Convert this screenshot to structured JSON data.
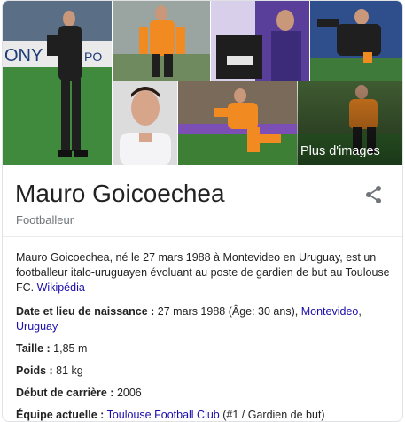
{
  "gallery": {
    "more_images_label": "Plus d'images",
    "tiles": [
      {
        "name": "photo-goalkeeper-black-kit"
      },
      {
        "name": "photo-orange-kit-standing"
      },
      {
        "name": "photo-holding-jersey"
      },
      {
        "name": "photo-diving-black-kit"
      },
      {
        "name": "photo-portrait-white-shirt"
      },
      {
        "name": "photo-orange-kit-saving"
      },
      {
        "name": "photo-orange-kit-crouching"
      }
    ]
  },
  "header": {
    "title": "Mauro Goicoechea",
    "subtitle": "Footballeur"
  },
  "description": {
    "text": "Mauro Goicoechea, né le 27 mars 1988 à Montevideo en Uruguay, est un footballeur italo-uruguayen évoluant au poste de gardien de but au Toulouse FC.",
    "source_link": "Wikipédia"
  },
  "facts": {
    "birth": {
      "label": "Date et lieu de naissance :",
      "value": "27 mars 1988 (Âge: 30 ans),",
      "link1": "Montevideo",
      "sep": ",",
      "link2": "Uruguay"
    },
    "height": {
      "label": "Taille :",
      "value": "1,85 m"
    },
    "weight": {
      "label": "Poids :",
      "value": "81 kg"
    },
    "career_start": {
      "label": "Début de carrière :",
      "value": "2006"
    },
    "team": {
      "label": "Équipe actuelle :",
      "link": "Toulouse Football Club",
      "value": "(#1 / Gardien de but)"
    }
  },
  "colors": {
    "link": "#1a0dab",
    "muted": "#70757a",
    "orange_kit": "#f28a22",
    "black_kit": "#222222"
  }
}
